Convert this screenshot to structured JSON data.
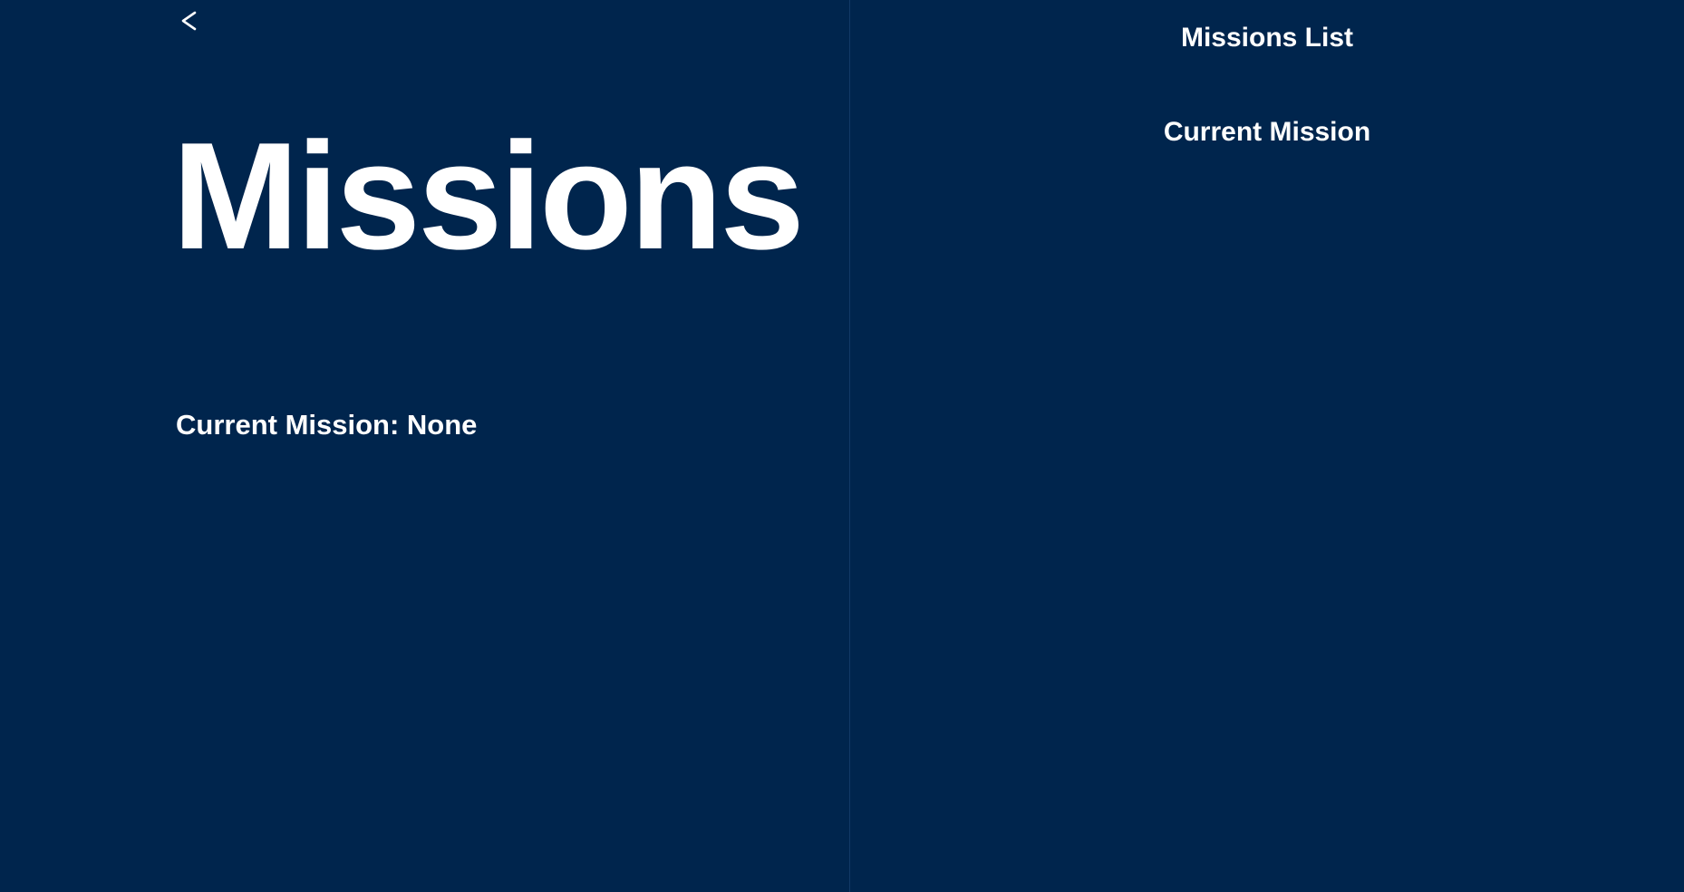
{
  "app": {
    "background_color": "#00254d",
    "text_color": "#ffffff",
    "divider_color": "#123a66"
  },
  "header": {
    "back_icon": "chevron-left-icon"
  },
  "main": {
    "title": "Missions",
    "current_mission_text": "Current Mission: None"
  },
  "sidebar": {
    "missions_list_heading": "Missions List",
    "current_mission_heading": "Current Mission"
  }
}
